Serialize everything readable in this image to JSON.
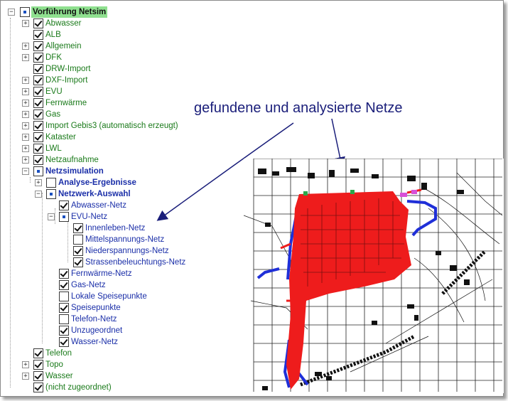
{
  "tree": {
    "root": "Vorführung Netsim",
    "items": [
      {
        "label": "Abwasser"
      },
      {
        "label": "ALB"
      },
      {
        "label": "Allgemein"
      },
      {
        "label": "DFK"
      },
      {
        "label": "DRW-Import"
      },
      {
        "label": "DXF-Import"
      },
      {
        "label": "EVU"
      },
      {
        "label": "Fernwärme"
      },
      {
        "label": "Gas"
      },
      {
        "label": "Import Gebis3 (automatisch erzeugt)"
      },
      {
        "label": "Kataster"
      },
      {
        "label": "LWL"
      },
      {
        "label": "Netzaufnahme"
      }
    ],
    "netzsimulation": {
      "label": "Netzsimulation",
      "analyse": "Analyse-Ergebnisse",
      "netzwerk": "Netzwerk-Auswahl",
      "abwasser_netz": "Abwasser-Netz",
      "evu_netz": "EVU-Netz",
      "evu_children": [
        "Innenleben-Netz",
        "Mittelspannungs-Netz",
        "Niederspannungs-Netz",
        "Strassenbeleuchtungs-Netz"
      ],
      "rest": [
        "Fernwärme-Netz",
        "Gas-Netz",
        "Lokale Speisepunkte",
        "Speisepunkte",
        "Telefon-Netz",
        "Unzugeordnet",
        "Wasser-Netz"
      ]
    },
    "bottom": [
      {
        "label": "Telefon"
      },
      {
        "label": "Topo"
      },
      {
        "label": "Wasser"
      },
      {
        "label": "(nicht zugeordnet)"
      }
    ]
  },
  "annotation": "gefundene und analysierte Netze",
  "colors": {
    "network": "#ee1c1c",
    "pipes": "#1f2fd8",
    "text_tree": "#1a7a1a",
    "text_blue": "#1a2ea8",
    "arrow": "#1a1e7a",
    "root_highlight": "#8fe08f"
  }
}
